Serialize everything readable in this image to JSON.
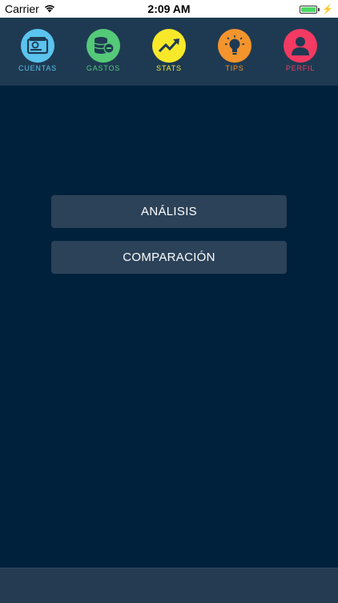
{
  "status_bar": {
    "carrier": "Carrier",
    "time": "2:09 AM",
    "battery_level": 1.0
  },
  "nav": {
    "items": [
      {
        "label": "CUENTAS",
        "icon": "wallet-icon",
        "color": "#5bc4ee"
      },
      {
        "label": "GASTOS",
        "icon": "coins-icon",
        "color": "#54c978"
      },
      {
        "label": "STATS",
        "icon": "trend-up-icon",
        "color": "#f7e92a"
      },
      {
        "label": "TIPS",
        "icon": "lightbulb-icon",
        "color": "#f3942d"
      },
      {
        "label": "PERFIL",
        "icon": "user-icon",
        "color": "#f23a62"
      }
    ]
  },
  "menu": {
    "analysis_label": "ANÁLISIS",
    "comparison_label": "COMPARACIÓN"
  },
  "colors": {
    "background": "#00213b",
    "nav_background": "#1e3a52",
    "button_background": "#2b4259"
  }
}
